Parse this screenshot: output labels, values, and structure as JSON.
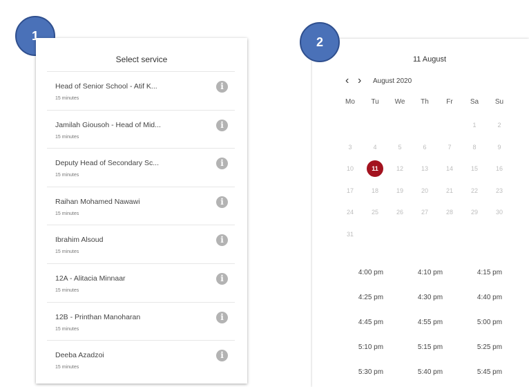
{
  "badges": [
    "1",
    "2"
  ],
  "services": {
    "title": "Select service",
    "items": [
      {
        "name": "Head of Senior School - Atif K...",
        "duration": "15 minutes"
      },
      {
        "name": "Jamilah Giousoh - Head of Mid...",
        "duration": "15 minutes"
      },
      {
        "name": "Deputy Head of Secondary Sc...",
        "duration": "15 minutes"
      },
      {
        "name": "Raihan Mohamed Nawawi",
        "duration": "15 minutes"
      },
      {
        "name": "Ibrahim Alsoud",
        "duration": "15 minutes"
      },
      {
        "name": "12A - Alitacia Minnaar",
        "duration": "15 minutes"
      },
      {
        "name": "12B - Printhan Manoharan",
        "duration": "15 minutes"
      },
      {
        "name": "Deeba Azadzoi",
        "duration": "15 minutes"
      }
    ],
    "info_icon": "info-icon"
  },
  "calendar": {
    "selected_date_title": "11 August",
    "month_label": "August 2020",
    "prev_icon": "chevron-left-icon",
    "next_icon": "chevron-right-icon",
    "weekdays": [
      "Mo",
      "Tu",
      "We",
      "Th",
      "Fr",
      "Sa",
      "Su"
    ],
    "weeks": [
      [
        "",
        "",
        "",
        "",
        "",
        "1",
        "2"
      ],
      [
        "3",
        "4",
        "5",
        "6",
        "7",
        "8",
        "9"
      ],
      [
        "10",
        "11",
        "12",
        "13",
        "14",
        "15",
        "16"
      ],
      [
        "17",
        "18",
        "19",
        "20",
        "21",
        "22",
        "23"
      ],
      [
        "24",
        "25",
        "26",
        "27",
        "28",
        "29",
        "30"
      ],
      [
        "31",
        "",
        "",
        "",
        "",
        "",
        ""
      ]
    ],
    "selected_day": "11",
    "selected_color": "#a3131f"
  },
  "times": [
    "4:00 pm",
    "4:10 pm",
    "4:15 pm",
    "4:25 pm",
    "4:30 pm",
    "4:40 pm",
    "4:45 pm",
    "4:55 pm",
    "5:00 pm",
    "5:10 pm",
    "5:15 pm",
    "5:25 pm",
    "5:30 pm",
    "5:40 pm",
    "5:45 pm"
  ]
}
